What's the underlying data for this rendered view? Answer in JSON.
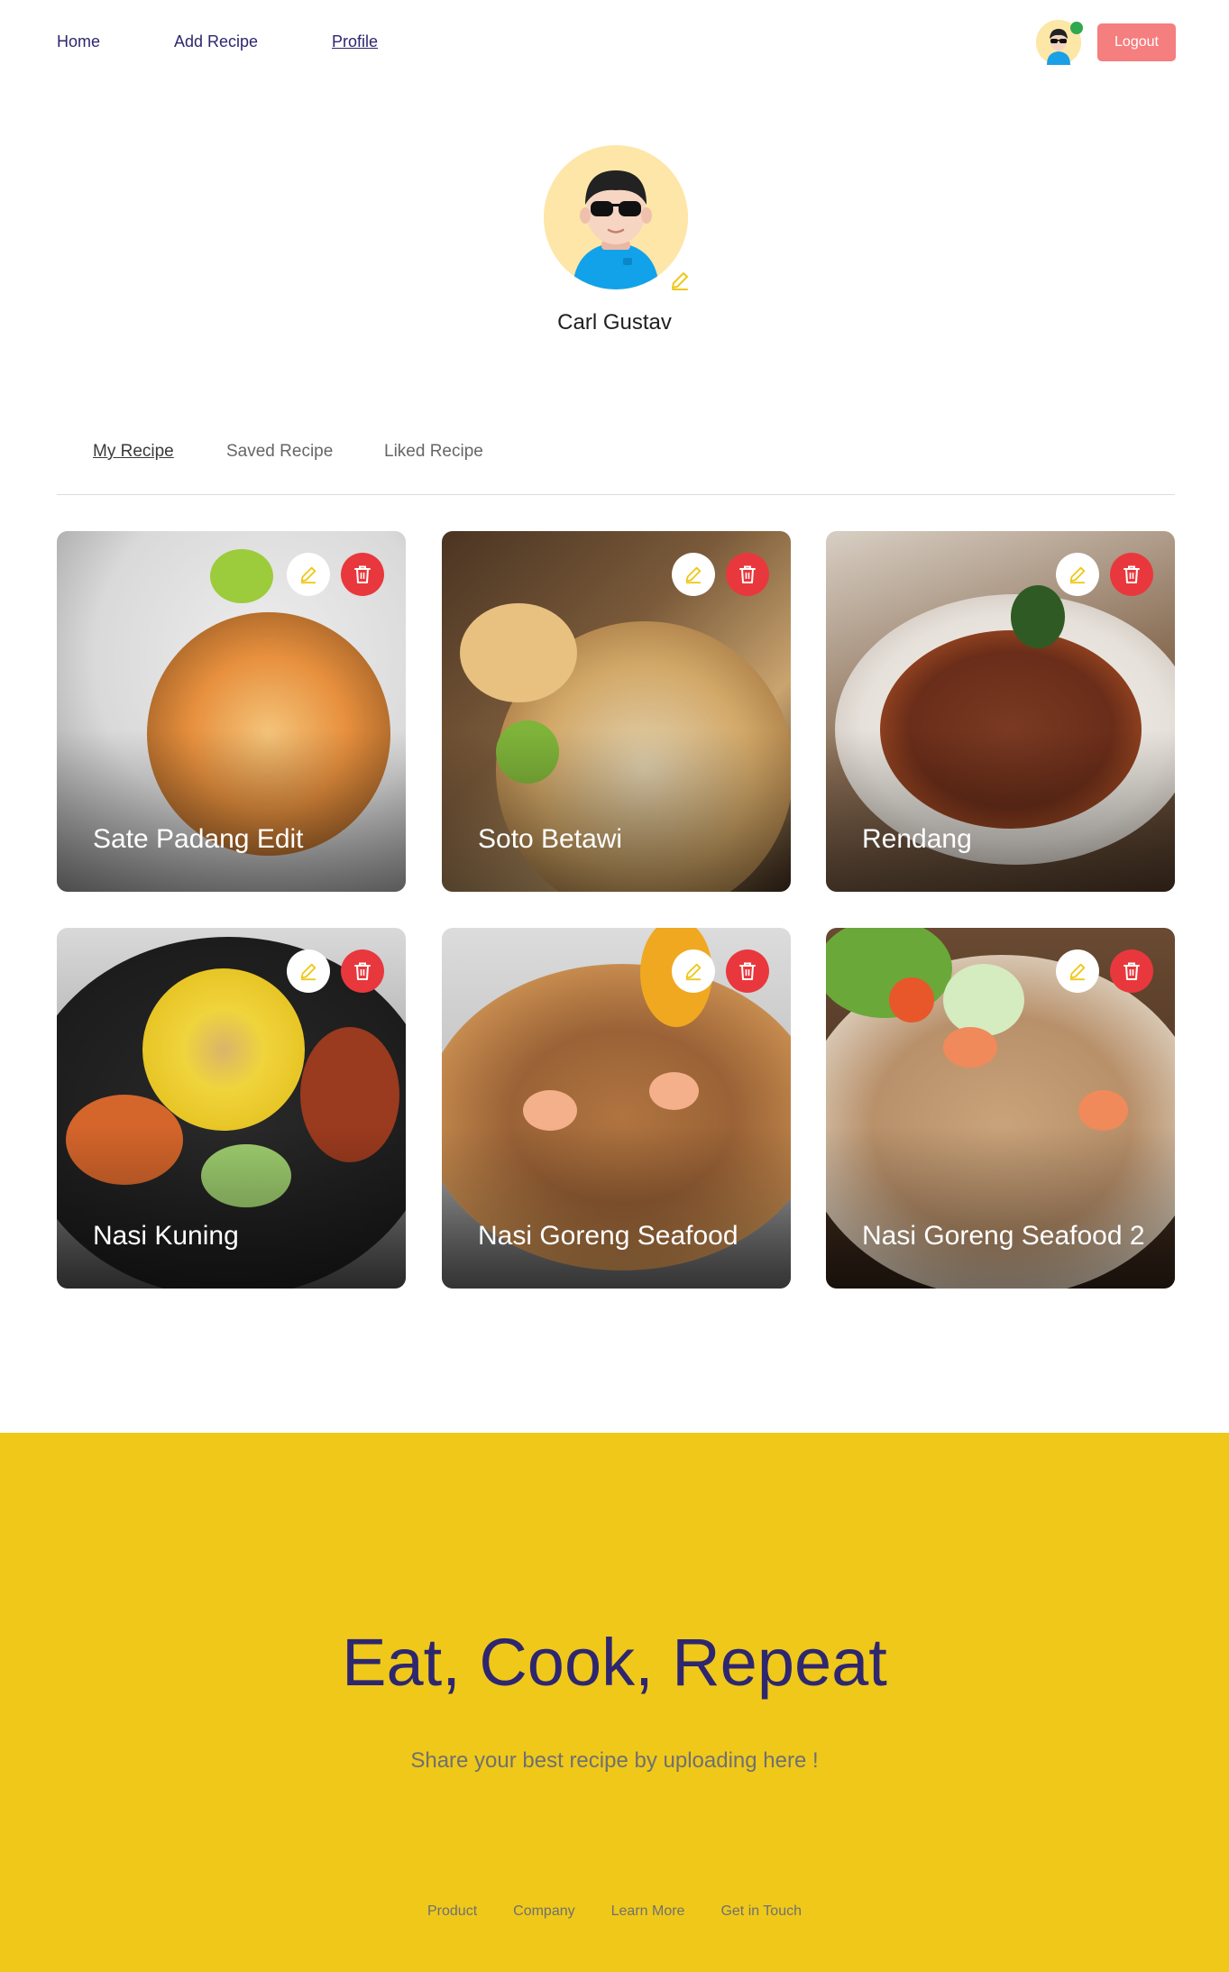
{
  "nav": {
    "home": "Home",
    "add_recipe": "Add Recipe",
    "profile": "Profile",
    "logout": "Logout"
  },
  "profile": {
    "name": "Carl Gustav"
  },
  "tabs": {
    "my_recipe": "My Recipe",
    "saved_recipe": "Saved Recipe",
    "liked_recipe": "Liked Recipe"
  },
  "recipes": [
    {
      "title": "Sate Padang Edit"
    },
    {
      "title": "Soto Betawi"
    },
    {
      "title": "Rendang"
    },
    {
      "title": "Nasi Kuning"
    },
    {
      "title": "Nasi Goreng Seafood"
    },
    {
      "title": "Nasi Goreng Seafood 2"
    }
  ],
  "footer": {
    "heading": "Eat, Cook, Repeat",
    "subtitle": "Share your best recipe by uploading here !",
    "links": [
      "Product",
      "Company",
      "Learn More",
      "Get in Touch"
    ]
  },
  "colors": {
    "primary": "#2e266f",
    "accent": "#efc81a",
    "danger": "#e8383d",
    "logout": "#f57e7e"
  }
}
